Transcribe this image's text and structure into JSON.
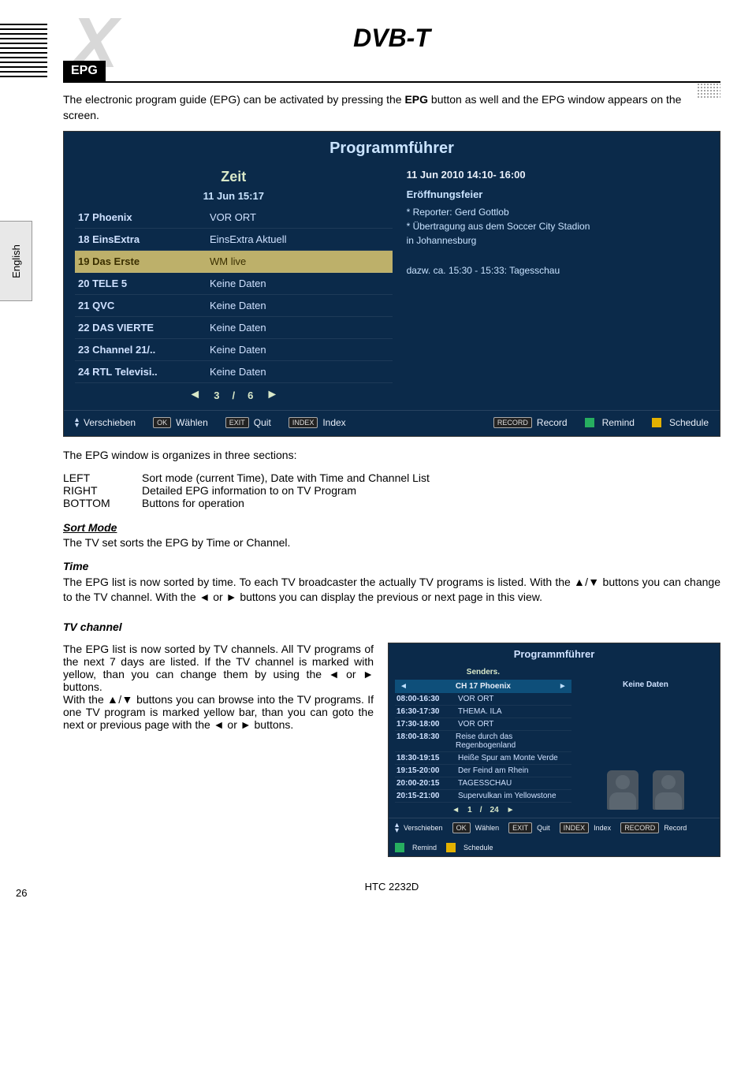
{
  "page": {
    "title": "DVB-T",
    "section": "EPG",
    "side_tab": "English",
    "page_number": "26",
    "footer_model": "HTC 2232D"
  },
  "intro": "The electronic program guide (EPG) can be activated by pressing the EPG button as well and the EPG window appears on the screen.",
  "intro_bold_word": "EPG",
  "epg_main": {
    "window_title": "Programmführer",
    "zeit_label": "Zeit",
    "zeit_datetime": "11 Jun  15:17",
    "channels": [
      {
        "name": "17 Phoenix",
        "prog": "VOR ORT",
        "selected": false
      },
      {
        "name": "18 EinsExtra",
        "prog": "EinsExtra Aktuell",
        "selected": false
      },
      {
        "name": "19 Das Erste",
        "prog": "WM live",
        "selected": true
      },
      {
        "name": "20 TELE 5",
        "prog": "Keine Daten",
        "selected": false
      },
      {
        "name": "21 QVC",
        "prog": "Keine Daten",
        "selected": false
      },
      {
        "name": "22 DAS VIERTE",
        "prog": "Keine Daten",
        "selected": false
      },
      {
        "name": "23 Channel 21/..",
        "prog": "Keine Daten",
        "selected": false
      },
      {
        "name": "24 RTL Televisi..",
        "prog": "Keine Daten",
        "selected": false
      }
    ],
    "pager": {
      "current": "3",
      "sep": "/",
      "total": "6"
    },
    "detail": {
      "date_line": "11 Jun 2010      14:10- 16:00",
      "headline": "Eröffnungsfeier",
      "lines": [
        "* Reporter: Gerd Gottlob",
        "* Übertragung aus dem Soccer City Stadion",
        "in Johannesburg"
      ],
      "extra": "dazw. ca. 15:30 - 15:33: Tagesschau"
    },
    "bottom": {
      "verschieben": "Verschieben",
      "wahlen_key": "OK",
      "wahlen": "Wählen",
      "quit_key": "EXIT",
      "quit": "Quit",
      "index_key": "INDEX",
      "index": "Index",
      "record_key": "RECORD",
      "record": "Record",
      "remind": "Remind",
      "schedule": "Schedule"
    }
  },
  "sections_intro": "The EPG window is organizes in three sections:",
  "defs": {
    "left_k": "LEFT",
    "left_v": "Sort mode (current Time), Date with Time and Channel List",
    "right_k": "RIGHT",
    "right_v": "Detailed EPG information to on TV Program",
    "bottom_k": "BOTTOM",
    "bottom_v": "Buttons for operation"
  },
  "sort_mode": {
    "heading": "Sort Mode",
    "text": "The TV set sorts the EPG by Time or Channel."
  },
  "time": {
    "heading": "Time",
    "text": "The EPG list is now sorted by time. To each TV broadcaster the actually TV programs is listed. With the ▲/▼ buttons you can change to the TV channel. With the ◄ or ► buttons you can display the previous or next page in this view."
  },
  "tv_channel": {
    "heading": "TV channel",
    "text": "The EPG list is now sorted by TV channels. All TV programs of the next 7 days are listed. If the TV channel is marked with yellow, than you can change them by using the ◄ or ► buttons.\nWith the ▲/▼ buttons you can browse into the TV programs. If one TV program is marked yellow bar, than you can goto the next or previous page with the ◄ or ► buttons."
  },
  "epg_small": {
    "window_title": "Programmführer",
    "senders_label": "Senders.",
    "channel_bar": "CH  17 Phoenix",
    "rows": [
      {
        "t": "08:00-16:30",
        "p": "VOR ORT"
      },
      {
        "t": "16:30-17:30",
        "p": "THEMA. ILA"
      },
      {
        "t": "17:30-18:00",
        "p": "VOR ORT"
      },
      {
        "t": "18:00-18:30",
        "p": "Reise durch das Regenbogenland"
      },
      {
        "t": "18:30-19:15",
        "p": "Heiße Spur am Monte Verde"
      },
      {
        "t": "19:15-20:00",
        "p": "Der Feind am Rhein"
      },
      {
        "t": "20:00-20:15",
        "p": "TAGESSCHAU"
      },
      {
        "t": "20:15-21:00",
        "p": "Supervulkan im Yellowstone"
      }
    ],
    "right_label": "Keine Daten",
    "pager": {
      "current": "1",
      "sep": "/",
      "total": "24"
    },
    "bottom": {
      "verschieben": "Verschieben",
      "wahlen_key": "OK",
      "wahlen": "Wählen",
      "quit_key": "EXIT",
      "quit": "Quit",
      "index_key": "INDEX",
      "index": "Index",
      "record_key": "RECORD",
      "record": "Record",
      "remind": "Remind",
      "schedule": "Schedule"
    }
  }
}
